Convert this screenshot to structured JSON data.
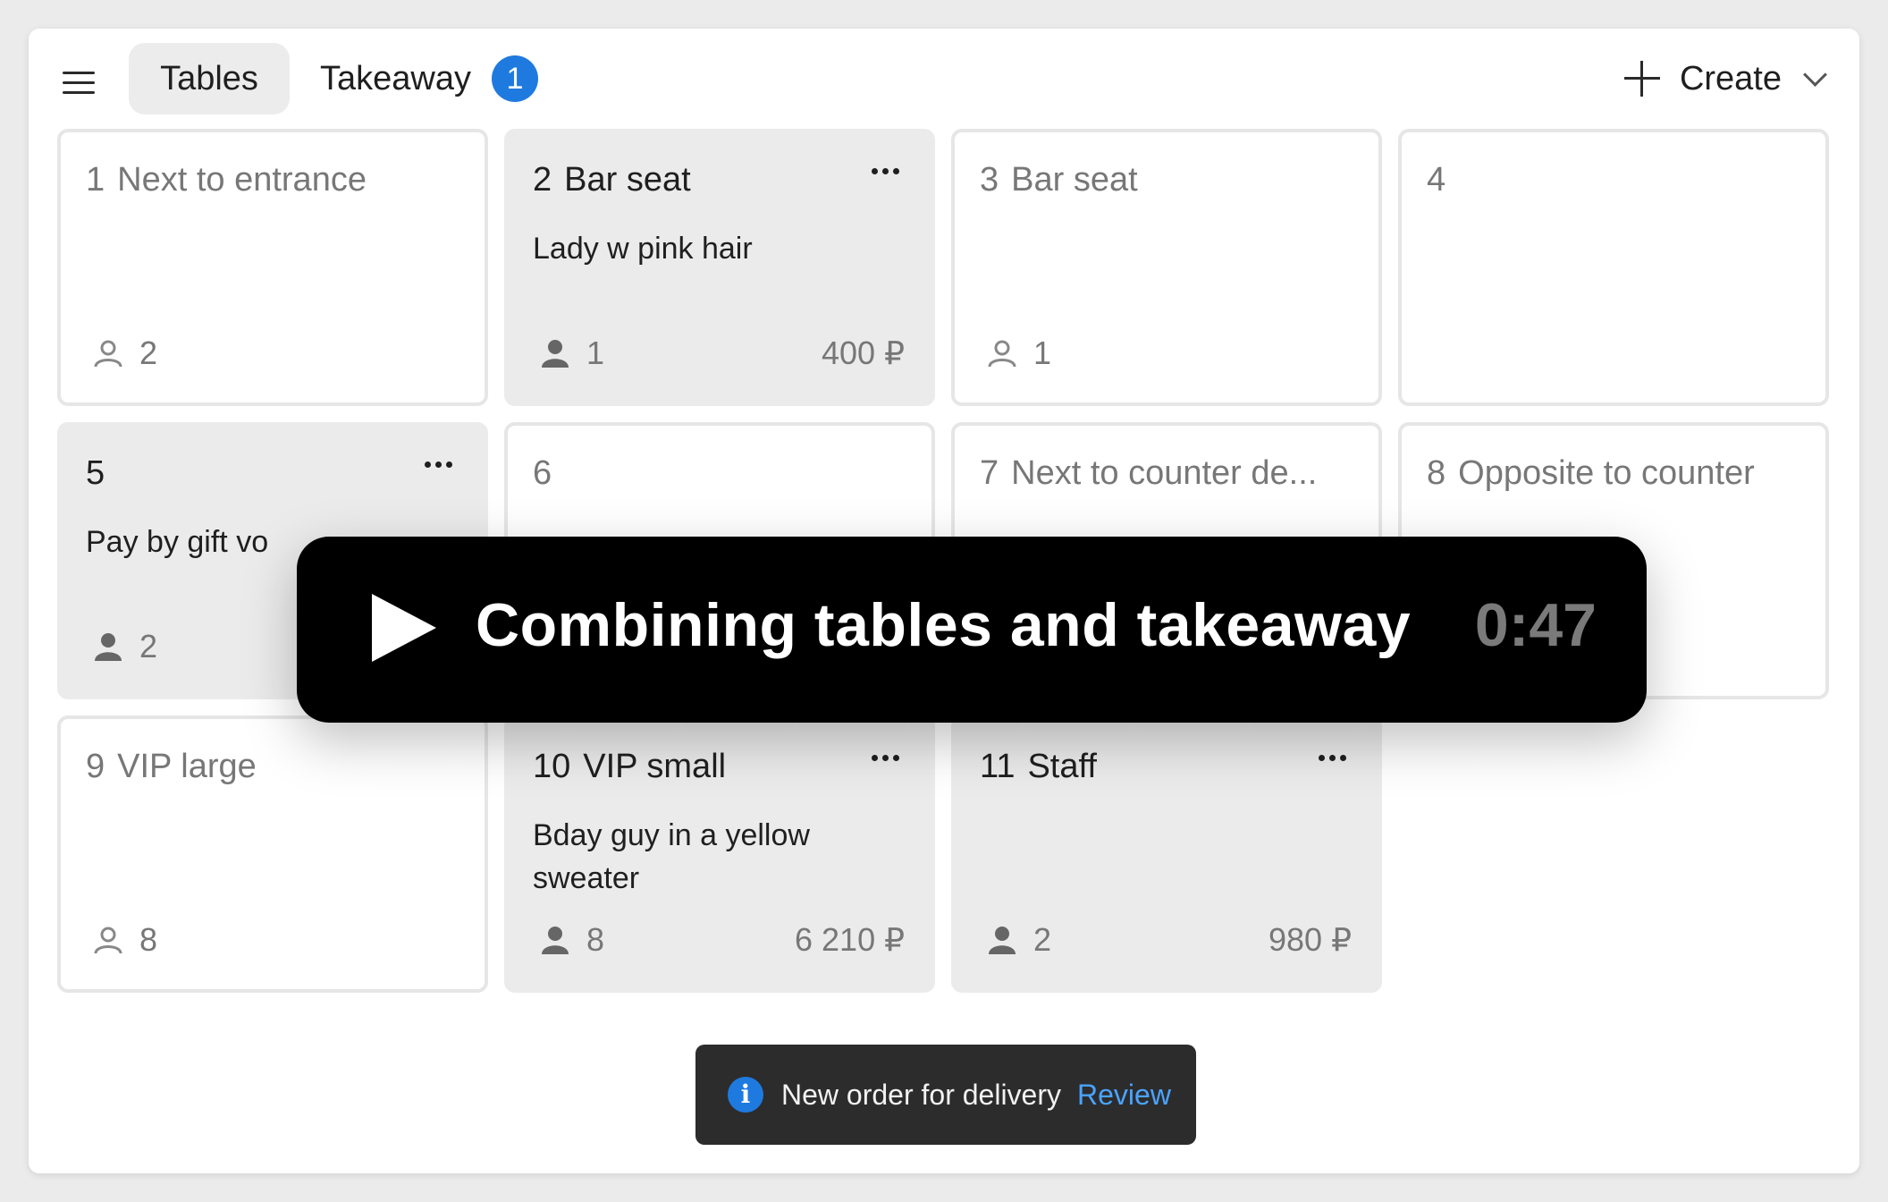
{
  "header": {
    "tabs": [
      {
        "label": "Tables",
        "active": true
      },
      {
        "label": "Takeaway",
        "badge": "1"
      }
    ],
    "create_label": "Create"
  },
  "tables": [
    {
      "num": "1",
      "name": "Next to entrance",
      "note": "",
      "guests": "2",
      "amount": "",
      "occupied": false
    },
    {
      "num": "2",
      "name": "Bar seat",
      "note": "Lady w pink hair",
      "guests": "1",
      "amount": "400 ₽",
      "occupied": true
    },
    {
      "num": "3",
      "name": "Bar seat",
      "note": "",
      "guests": "1",
      "amount": "",
      "occupied": false
    },
    {
      "num": "4",
      "name": "",
      "note": "",
      "guests": "",
      "amount": "",
      "occupied": false
    },
    {
      "num": "5",
      "name": "",
      "note": "Pay by gift vo",
      "guests": "2",
      "amount": "",
      "occupied": true
    },
    {
      "num": "6",
      "name": "",
      "note": "",
      "guests": "",
      "amount": "",
      "occupied": false
    },
    {
      "num": "7",
      "name": "Next to counter de...",
      "note": "",
      "guests": "",
      "amount": "",
      "occupied": false
    },
    {
      "num": "8",
      "name": "Opposite to counter",
      "note": "",
      "guests": "",
      "amount": "",
      "occupied": false
    },
    {
      "num": "9",
      "name": "VIP large",
      "note": "",
      "guests": "8",
      "amount": "",
      "occupied": false
    },
    {
      "num": "10",
      "name": "VIP small",
      "note": "Bday guy in a yellow sweater",
      "guests": "8",
      "amount": "6 210 ₽",
      "occupied": true
    },
    {
      "num": "11",
      "name": "Staff",
      "note": "",
      "guests": "2",
      "amount": "980 ₽",
      "occupied": true
    }
  ],
  "video": {
    "title": "Combining tables and takeaway",
    "duration": "0:47"
  },
  "toast": {
    "text": "New order for delivery",
    "link": "Review"
  },
  "colors": {
    "accent": "#1f7ae0",
    "link": "#4aa3ff"
  }
}
